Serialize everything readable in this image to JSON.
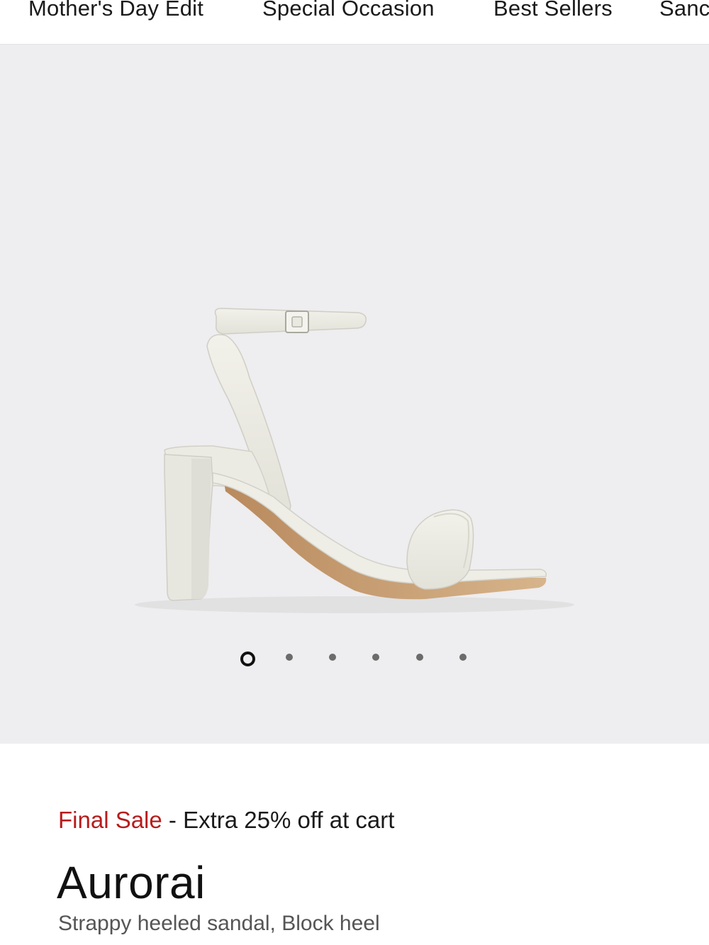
{
  "nav": {
    "items": [
      {
        "label": "Mother's Day Edit"
      },
      {
        "label": "Special Occasion"
      },
      {
        "label": "Best Sellers"
      },
      {
        "label": "Sanc"
      }
    ]
  },
  "gallery": {
    "image_count": 6,
    "active_index": 0,
    "background": "#eeedef"
  },
  "product": {
    "sale_label": "Final Sale",
    "promo_text": " - Extra 25% off at cart",
    "name": "Aurorai",
    "description": "Strappy heeled sandal, Block heel"
  },
  "colors": {
    "sale_red": "#b71c1c",
    "text": "#111111",
    "muted": "#555555"
  }
}
